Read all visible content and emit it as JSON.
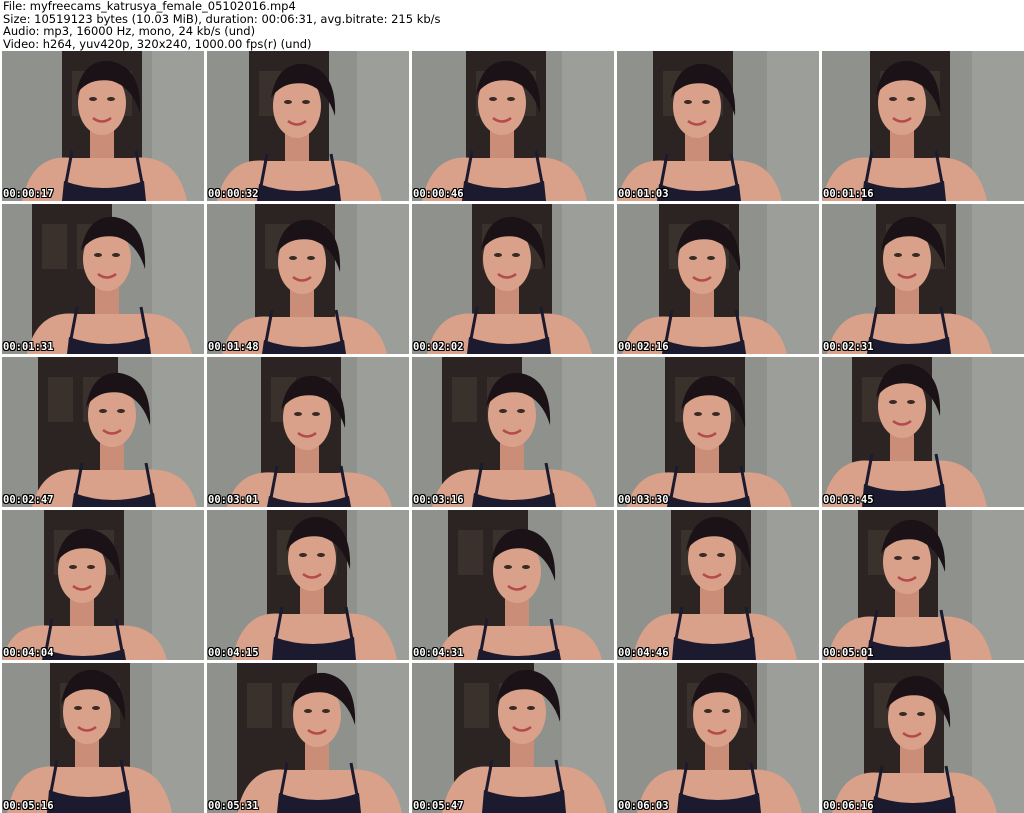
{
  "header": {
    "line_file": "File: myfreecams_katrusya_female_05102016.mp4",
    "line_size": "Size: 10519123 bytes (10.03 MiB), duration: 00:06:31, avg.bitrate: 215 kb/s",
    "line_audio": "Audio: mp3, 16000 Hz, mono, 24 kb/s (und)",
    "line_video": "Video: h264, yuv420p, 320x240, 1000.00 fps(r) (und)"
  },
  "thumbnails": [
    {
      "timestamp": "00:00:17"
    },
    {
      "timestamp": "00:00:32"
    },
    {
      "timestamp": "00:00:46"
    },
    {
      "timestamp": "00:01:03"
    },
    {
      "timestamp": "00:01:16"
    },
    {
      "timestamp": "00:01:31"
    },
    {
      "timestamp": "00:01:48"
    },
    {
      "timestamp": "00:02:02"
    },
    {
      "timestamp": "00:02:16"
    },
    {
      "timestamp": "00:02:31"
    },
    {
      "timestamp": "00:02:47"
    },
    {
      "timestamp": "00:03:01"
    },
    {
      "timestamp": "00:03:16"
    },
    {
      "timestamp": "00:03:30"
    },
    {
      "timestamp": "00:03:45"
    },
    {
      "timestamp": "00:04:04"
    },
    {
      "timestamp": "00:04:15"
    },
    {
      "timestamp": "00:04:31"
    },
    {
      "timestamp": "00:04:46"
    },
    {
      "timestamp": "00:05:01"
    },
    {
      "timestamp": "00:05:16"
    },
    {
      "timestamp": "00:05:31"
    },
    {
      "timestamp": "00:05:47"
    },
    {
      "timestamp": "00:06:03"
    },
    {
      "timestamp": "00:06:16"
    }
  ],
  "colors": {
    "wall": "#8f918c",
    "door": "#2b2422",
    "skin": "#d9a08a",
    "hair": "#1a1216",
    "top": "#1c1a2e"
  }
}
